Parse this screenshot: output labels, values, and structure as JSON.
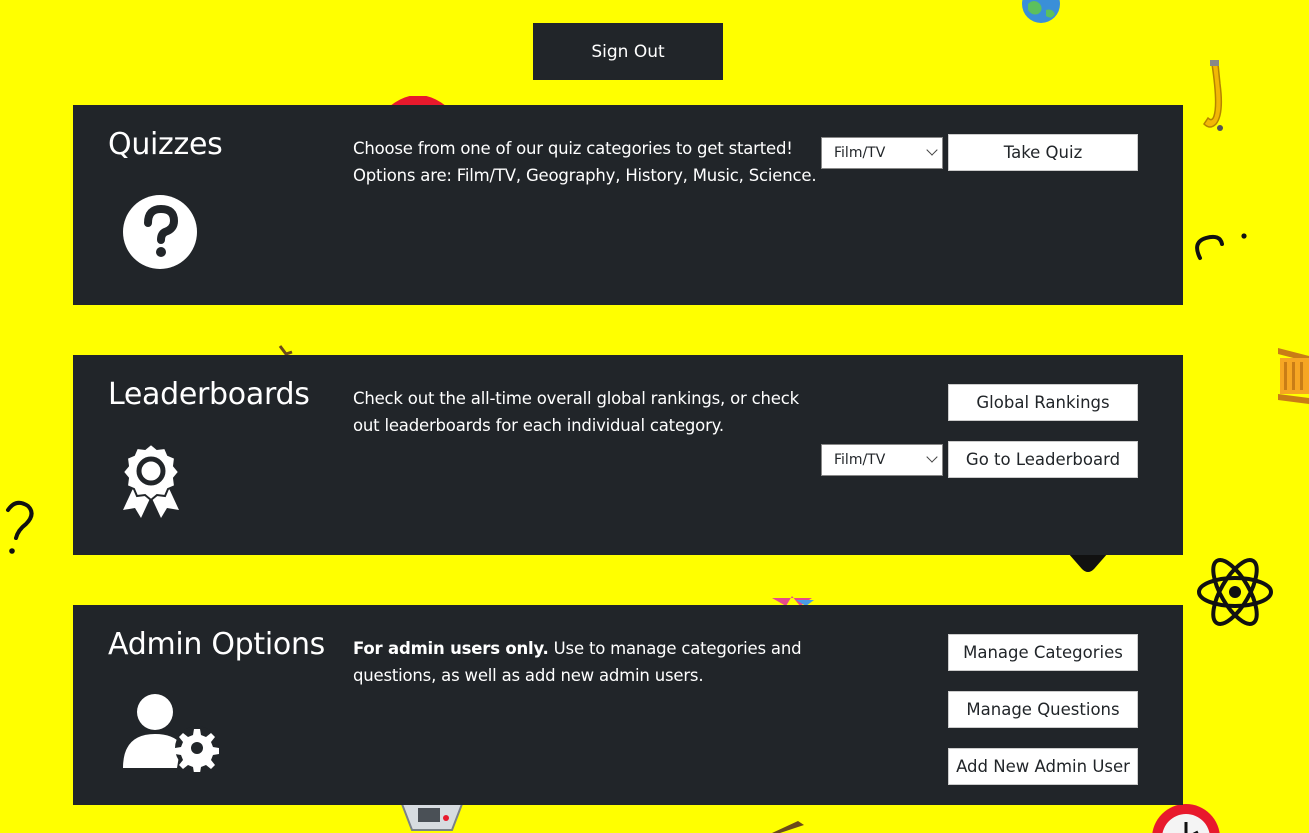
{
  "header": {
    "sign_out_label": "Sign Out"
  },
  "quizzes": {
    "title": "Quizzes",
    "description": "Choose from one of our quiz categories to get started! Options are: Film/TV, Geography, History, Music, Science.",
    "category_select": "Film/TV",
    "take_quiz_label": "Take Quiz",
    "icon": "question-circle-icon"
  },
  "leaderboards": {
    "title": "Leaderboards",
    "description": "Check out the all-time overall global rankings, or check out leaderboards for each individual category.",
    "global_rankings_label": "Global Rankings",
    "category_select": "Film/TV",
    "go_to_leaderboard_label": "Go to Leaderboard",
    "icon": "award-ribbon-icon"
  },
  "admin": {
    "title": "Admin Options",
    "description_bold": "For admin users only.",
    "description_rest": " Use to manage categories and questions, as well as add new admin users.",
    "manage_categories_label": "Manage Categories",
    "manage_questions_label": "Manage Questions",
    "add_admin_label": "Add New Admin User",
    "icon": "user-gear-icon"
  },
  "background": {
    "color": "#ffff00",
    "doodles": [
      "globe-icon",
      "saxophone-icon",
      "question-mark-icon",
      "column-building-icon",
      "atom-icon",
      "red-ball-icon",
      "clock-icon",
      "tv-icon"
    ]
  },
  "colors": {
    "panel": "#212529",
    "text": "#ffffff",
    "button_bg": "#ffffff"
  }
}
